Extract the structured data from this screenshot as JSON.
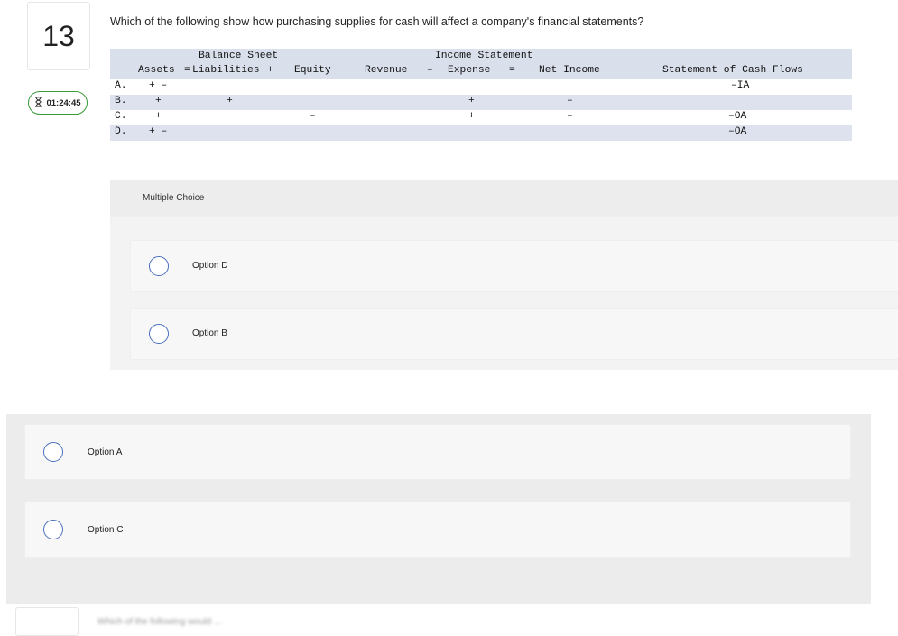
{
  "question": {
    "number": "13",
    "timer": "01:24:45",
    "text": "Which of the following show how purchasing supplies for cash will affect a company's financial statements?"
  },
  "table": {
    "group_headers": {
      "balance_sheet": "Balance Sheet",
      "income_statement": "Income Statement"
    },
    "columns": {
      "assets": "Assets",
      "eq1": "=",
      "liabilities": "Liabilities",
      "plus": "+",
      "equity": "Equity",
      "revenue": "Revenue",
      "minus": "–",
      "expense": "Expense",
      "eq2": "=",
      "net_income": "Net Income",
      "cash_flows": "Statement of Cash Flows"
    },
    "rows": [
      {
        "label": "A.",
        "assets": "+ –",
        "liabilities": "",
        "equity": "",
        "expense": "",
        "net_income": "",
        "cash_flows": "–IA"
      },
      {
        "label": "B.",
        "assets": "+",
        "liabilities": "+",
        "equity": "",
        "expense": "+",
        "net_income": "–",
        "cash_flows": ""
      },
      {
        "label": "C.",
        "assets": "+",
        "liabilities": "",
        "equity": "–",
        "expense": "+",
        "net_income": "–",
        "cash_flows": "–OA"
      },
      {
        "label": "D.",
        "assets": "+ –",
        "liabilities": "",
        "equity": "",
        "expense": "",
        "net_income": "",
        "cash_flows": "–OA"
      }
    ]
  },
  "multiple_choice": {
    "title": "Multiple Choice",
    "options": [
      "Option D",
      "Option B",
      "Option A",
      "Option C"
    ]
  },
  "next_question_preview": "Which of the following would ..."
}
